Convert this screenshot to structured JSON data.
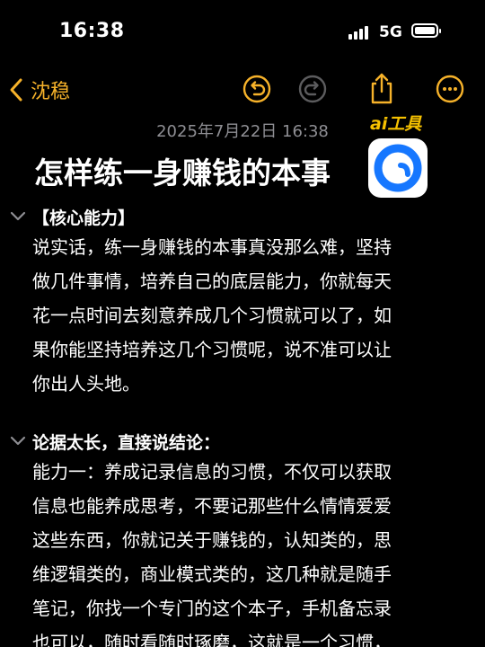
{
  "status_bar": {
    "time": "16:38",
    "network": "5G",
    "icons": [
      "cellular-signal-icon",
      "battery-icon"
    ]
  },
  "nav": {
    "back_label": "沈稳",
    "icons": [
      "chevron-left-icon",
      "undo-icon",
      "redo-icon",
      "share-icon",
      "more-icon"
    ],
    "accent_color": "#f6b22a",
    "disabled_color": "#5c5c5e"
  },
  "note": {
    "date": "2025年7月22日 16:38",
    "title": "怎样练一身赚钱的本事",
    "watermark": {
      "text": "ai工具",
      "icon": "app-logo-icon",
      "text_color": "#f6c100"
    },
    "sections": [
      {
        "heading": "【核心能力】",
        "collapse_icon": "chevron-down-icon",
        "lines": [
          "说实话，练一身赚钱的本事真没那么难，坚持",
          "做几件事情，培养自己的底层能力，你就每天",
          "花一点时间去刻意养成几个习惯就可以了，如",
          "果你能坚持培养这几个习惯呢，说不准可以让",
          "你出人头地。"
        ]
      },
      {
        "heading": "论据太长，直接说结论：",
        "collapse_icon": "chevron-down-icon",
        "lines": [
          "能力一：养成记录信息的习惯，不仅可以获取",
          "信息也能养成思考，不要记那些什么情情爱爱",
          "这些东西，你就记关于赚钱的，认知类的，思",
          "维逻辑类的，商业模式类的，这几种就是随手",
          "笔记，你找一个专门的这个本子，手机备忘录",
          "也可以，随时看随时琢磨，这就是一个习惯，"
        ]
      }
    ]
  }
}
